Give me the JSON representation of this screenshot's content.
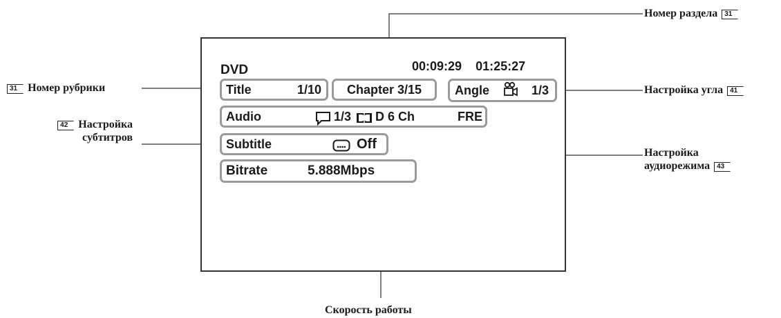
{
  "osd": {
    "disc_type": "DVD",
    "elapsed_time": "00:09:29",
    "total_time": "01:25:27",
    "title_label": "Title",
    "title_value": "1/10",
    "chapter": "Chapter 3/15",
    "angle_label": "Angle",
    "angle_value": "1/3",
    "audio_label": "Audio",
    "audio_value": "1/3",
    "audio_format": "D 6 Ch",
    "audio_lang": "FRE",
    "subtitle_label": "Subtitle",
    "subtitle_value": "Off",
    "bitrate_label": "Bitrate",
    "bitrate_value": "5.888Mbps"
  },
  "callouts": {
    "chapter_number": "Номер раздела",
    "chapter_ref": "31",
    "title_number": "Номер рубрики",
    "title_ref": "31",
    "angle_setting": "Настройка угла",
    "angle_ref": "41",
    "subtitle_setting_line1": "Настройка",
    "subtitle_setting_line2": "субтитров",
    "subtitle_ref": "42",
    "audio_setting_line1": "Настройка",
    "audio_setting_line2": "аудиорежима",
    "audio_ref": "43",
    "bitrate": "Скорость работы"
  },
  "icons": [
    "speech-bubble-icon",
    "dolby-digital-icon",
    "camera-icon",
    "subtitle-icon"
  ]
}
